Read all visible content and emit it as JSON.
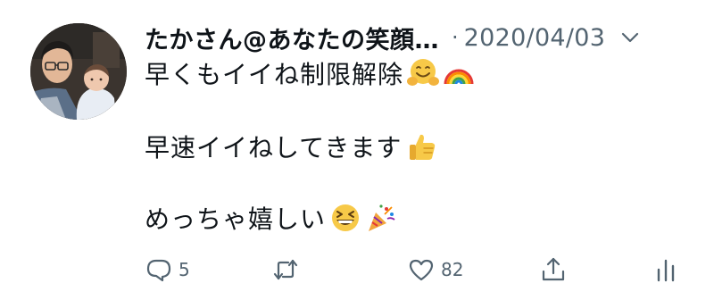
{
  "tweet": {
    "author": {
      "display_name": "たかさん@あなたの笑顔…"
    },
    "separator": "·",
    "timestamp": "2020/04/03",
    "lines": [
      "早くもイイね制限解除",
      "早速イイねしてきます",
      "めっちゃ嬉しい"
    ],
    "emojis": {
      "line1": [
        "hugging-face-emoji",
        "rainbow-emoji"
      ],
      "line2": [
        "thumbs-up-emoji"
      ],
      "line3": [
        "grinning-squinting-face-emoji",
        "party-popper-emoji"
      ]
    }
  },
  "actions": {
    "reply_count": "5",
    "retweet_count": "",
    "like_count": "82",
    "icons": [
      "reply-icon",
      "retweet-icon",
      "like-icon",
      "share-icon",
      "analytics-icon"
    ]
  },
  "colors": {
    "text_primary": "#0f1419",
    "text_secondary": "#536471",
    "background": "#ffffff"
  }
}
